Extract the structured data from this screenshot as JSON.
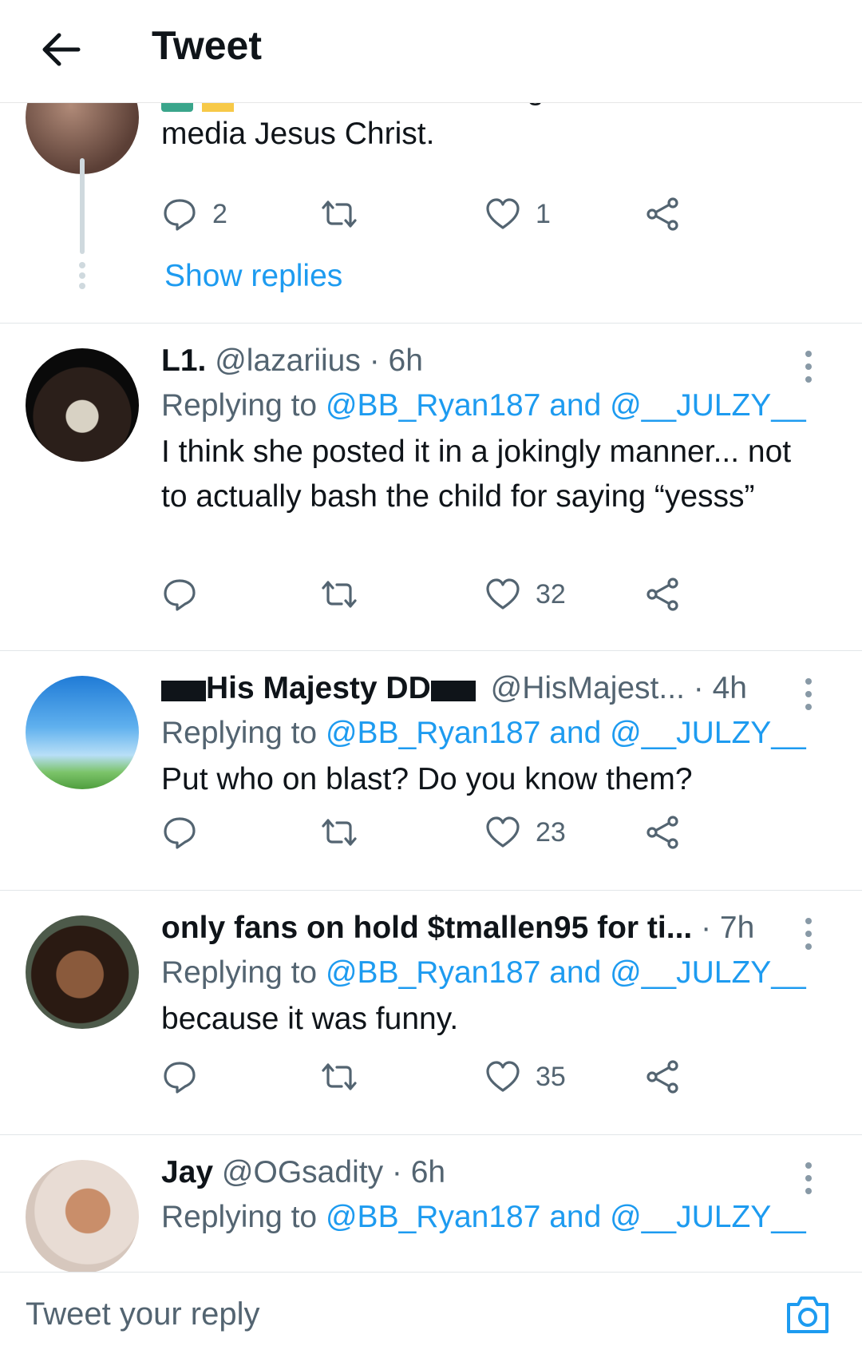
{
  "header": {
    "title": "Tweet"
  },
  "parent_tweet": {
    "text_cut": "but still tho don't bring them on social",
    "text_end": "media Jesus Christ.",
    "reply_count": "2",
    "like_count": "1",
    "show_replies": "Show replies"
  },
  "tweets": [
    {
      "name": "L1.",
      "handle": "@lazariius",
      "time": "· 6h",
      "replying_to": "Replying to",
      "mention1": "@BB_Ryan187",
      "and": "and",
      "mention2": "@__JULZY__",
      "text": "I think she posted it in a jokingly manner... not to actually bash the child for saying “yesss”",
      "reply_count": "",
      "like_count": "32"
    },
    {
      "name": "His Majesty DD",
      "handle": "@HisMajest...",
      "time": "· 4h",
      "replying_to": "Replying to",
      "mention1": "@BB_Ryan187",
      "and": "and",
      "mention2": "@__JULZY__",
      "text": "Put who on blast? Do you know them?",
      "reply_count": "",
      "like_count": "23"
    },
    {
      "name": "only fans on hold $tmallen95 for ti...",
      "handle": "",
      "time": "· 7h",
      "replying_to": "Replying to",
      "mention1": "@BB_Ryan187",
      "and": "and",
      "mention2": "@__JULZY__",
      "text": "because it was funny.",
      "reply_count": "",
      "like_count": "35"
    },
    {
      "name": "Jay",
      "handle": "@OGsadity",
      "time": "· 6h",
      "replying_to": "Replying to",
      "mention1": "@BB_Ryan187",
      "and": "and",
      "mention2": "@__JULZY__"
    }
  ],
  "reply_bar": {
    "placeholder": "Tweet your reply"
  },
  "colors": {
    "link": "#1d9bf0",
    "muted": "#536471",
    "text": "#0f1419",
    "divider": "#e2e6e9"
  },
  "icons": [
    "back-arrow-icon",
    "reply-icon",
    "retweet-icon",
    "like-icon",
    "share-icon",
    "more-icon",
    "camera-icon"
  ]
}
